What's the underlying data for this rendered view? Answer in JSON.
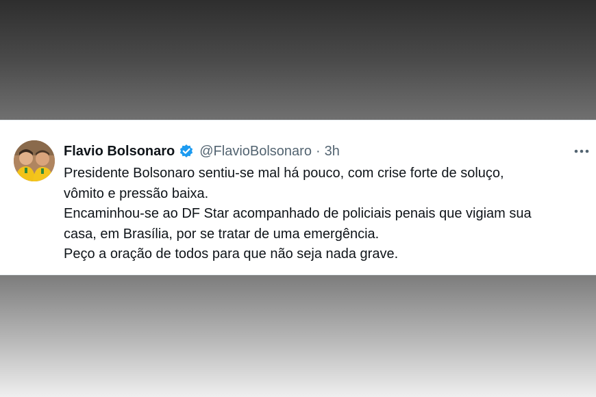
{
  "tweet": {
    "author": {
      "display_name": "Flavio Bolsonaro",
      "verified": true,
      "handle": "@FlavioBolsonaro",
      "avatar_icon": "avatar-photo"
    },
    "separator": "·",
    "time": "3h",
    "more_icon": "more-horizontal-icon",
    "lines": [
      "Presidente Bolsonaro sentiu-se mal há pouco, com crise forte de soluço,",
      "vômito e pressão baixa.",
      "Encaminhou-se ao DF Star acompanhado de policiais penais que vigiam sua",
      "casa, em Brasília, por se tratar de uma emergência.",
      "Peço a oração de todos para que não seja nada grave."
    ]
  },
  "colors": {
    "verified_badge": "#1d9bf0",
    "name_text": "#0f1419",
    "secondary_text": "#536471"
  }
}
